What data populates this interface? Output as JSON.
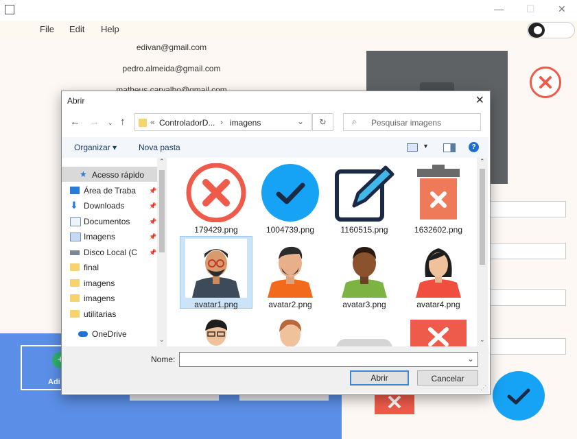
{
  "window": {
    "menu": [
      "File",
      "Edit",
      "Help"
    ],
    "controls": {
      "minimize": "—",
      "maximize": "☐",
      "close": "✕"
    }
  },
  "emails": [
    "edivan@gmail.com",
    "pedro.almeida@gmail.com",
    "matheus.carvalho@gmail.com"
  ],
  "add_card_label": "Adi",
  "dialog": {
    "title": "Abrir",
    "close": "✕",
    "breadcrumb": {
      "separator": "«",
      "segments": [
        "ControladorD...",
        "imagens"
      ]
    },
    "search_placeholder": "Pesquisar imagens",
    "toolbar": {
      "organize": "Organizar",
      "new_folder": "Nova pasta"
    },
    "nav": {
      "quick_access": "Acesso rápido",
      "items": [
        "Área de Traba",
        "Downloads",
        "Documentos",
        "Imagens",
        "Disco Local (C",
        "final",
        "imagens",
        "imagens",
        "utilitarias"
      ],
      "onedrive": "OneDrive"
    },
    "files": [
      "179429.png",
      "1004739.png",
      "1160515.png",
      "1632602.png",
      "avatar1.png",
      "avatar2.png",
      "avatar3.png",
      "avatar4.png"
    ],
    "filename_label": "Nome:",
    "filename_value": "",
    "open_button": "Abrir",
    "cancel_button": "Cancelar"
  },
  "colors": {
    "accent_blue": "#16a3f5",
    "red": "#ef5b4a",
    "panel_blue": "#5b8ee6"
  }
}
